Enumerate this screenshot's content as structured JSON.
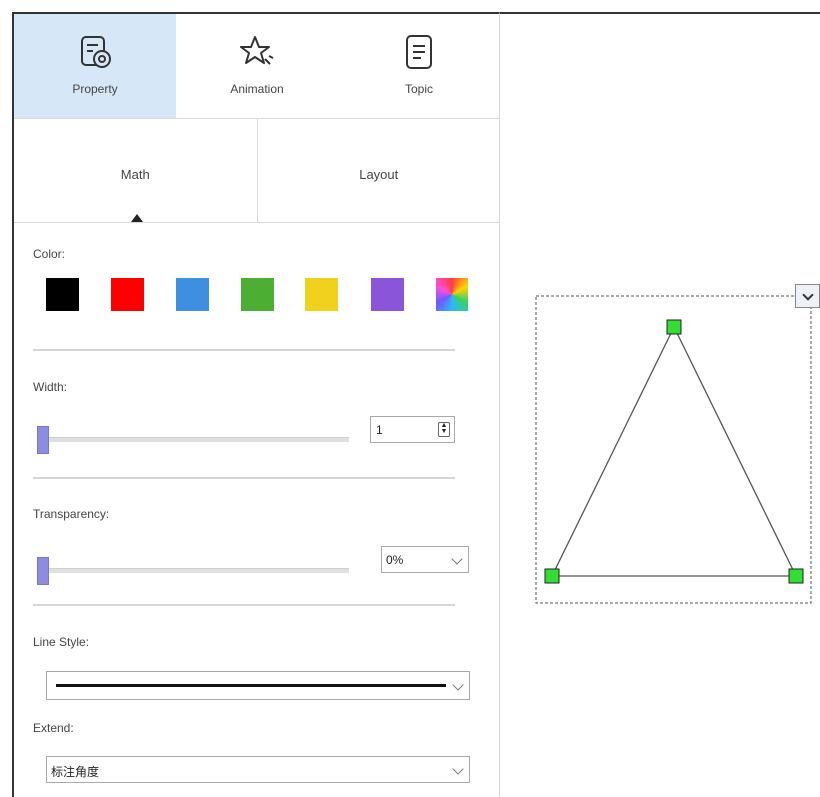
{
  "tabs": [
    {
      "label": "Property",
      "icon": "property-icon"
    },
    {
      "label": "Animation",
      "icon": "animation-star-icon"
    },
    {
      "label": "Topic",
      "icon": "topic-document-icon"
    }
  ],
  "subtabs": [
    "Math",
    "Layout"
  ],
  "color": {
    "label": "Color:",
    "swatches": [
      "#000000",
      "#ff0000",
      "#3f8fe0",
      "#4caf34",
      "#f0d21e",
      "#8a55d8",
      "gradient"
    ]
  },
  "width": {
    "label": "Width:",
    "value": "1"
  },
  "transparency": {
    "label": "Transparency:",
    "value": "0%"
  },
  "line_style": {
    "label": "Line Style:"
  },
  "extend": {
    "label": "Extend:",
    "value": "标注角度"
  },
  "shape": {
    "type": "triangle",
    "handle_color": "#33dd33"
  }
}
